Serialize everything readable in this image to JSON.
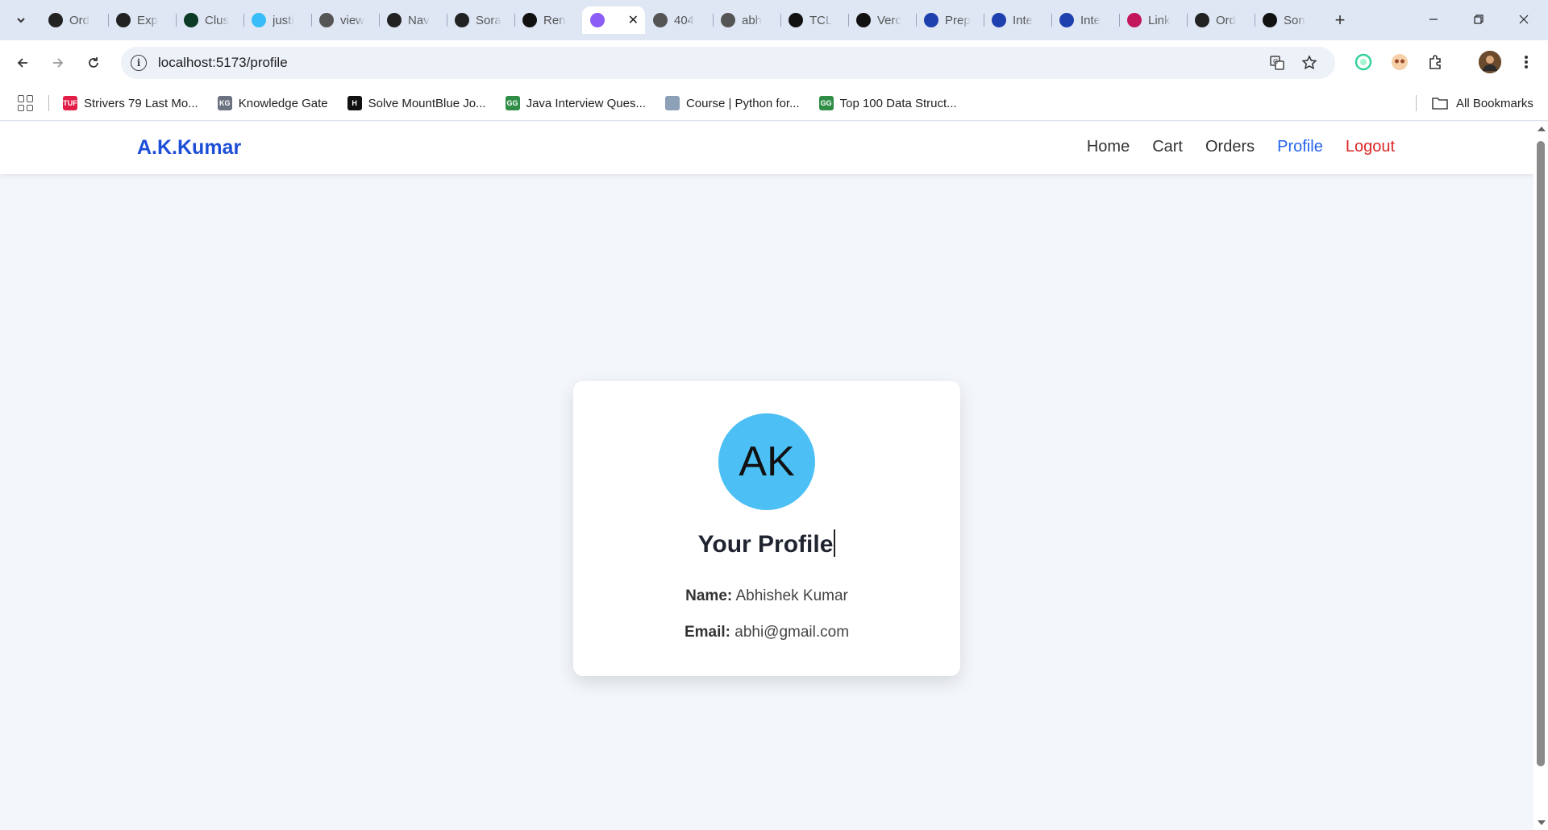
{
  "browser": {
    "tabs": [
      {
        "title": "Ord",
        "icon": "openai-icon",
        "color": "#222222"
      },
      {
        "title": "Exp",
        "icon": "express-icon",
        "color": "#222222"
      },
      {
        "title": "Clus",
        "icon": "mongodb-icon",
        "color": "#0b3b24"
      },
      {
        "title": "justi",
        "icon": "tailwind-icon",
        "color": "#38bdf8"
      },
      {
        "title": "view",
        "icon": "globe-icon",
        "color": "#555555"
      },
      {
        "title": "Nav",
        "icon": "openai-icon",
        "color": "#222222"
      },
      {
        "title": "Sora",
        "icon": "play-icon",
        "color": "#222222"
      },
      {
        "title": "Ren",
        "icon": "render-icon",
        "color": "#111111"
      },
      {
        "title": "",
        "icon": "vite-icon",
        "color": "#8b5cf6",
        "active": true
      },
      {
        "title": "404",
        "icon": "globe-icon",
        "color": "#555555"
      },
      {
        "title": "abh",
        "icon": "globe-icon",
        "color": "#555555"
      },
      {
        "title": "TCL",
        "icon": "amazon-icon",
        "color": "#111111"
      },
      {
        "title": "Verc",
        "icon": "vercel-icon",
        "color": "#111111"
      },
      {
        "title": "Prep",
        "icon": "interviewbit-icon",
        "color": "#1e40af"
      },
      {
        "title": "Inte",
        "icon": "interviewbit-icon",
        "color": "#1e40af"
      },
      {
        "title": "Inte",
        "icon": "interviewbit-icon",
        "color": "#1e40af"
      },
      {
        "title": "Link",
        "icon": "link-icon",
        "color": "#c2185b"
      },
      {
        "title": "Ord",
        "icon": "openai-icon",
        "color": "#222222"
      },
      {
        "title": "Son",
        "icon": "amazon-icon",
        "color": "#111111"
      }
    ],
    "url": "localhost:5173/profile",
    "bookmarks": [
      {
        "label": "Strivers 79 Last Mo...",
        "icon": "tuf-icon",
        "color": "#e11d48",
        "badge": "TUF"
      },
      {
        "label": "Knowledge Gate",
        "icon": "kg-icon",
        "color": "#6b7280",
        "badge": "KG"
      },
      {
        "label": "Solve MountBlue Jo...",
        "icon": "hackerearth-icon",
        "color": "#111111",
        "badge": "H"
      },
      {
        "label": "Java Interview Ques...",
        "icon": "gfg-icon",
        "color": "#2f8d46",
        "badge": "GG"
      },
      {
        "label": "Course | Python for...",
        "icon": "course-icon",
        "color": "#8ca0b8",
        "badge": ""
      },
      {
        "label": "Top 100 Data Struct...",
        "icon": "gfg-icon",
        "color": "#2f8d46",
        "badge": "GG"
      }
    ],
    "all_bookmarks": "All Bookmarks"
  },
  "site": {
    "brand": "A.K.Kumar",
    "nav": [
      {
        "label": "Home"
      },
      {
        "label": "Cart"
      },
      {
        "label": "Orders"
      },
      {
        "label": "Profile",
        "current": true
      },
      {
        "label": "Logout",
        "danger": true
      }
    ]
  },
  "profile": {
    "initials": "AK",
    "title": "Your Profile",
    "name_label": "Name:",
    "name": "Abhishek Kumar",
    "email_label": "Email:",
    "email": "abhi@gmail.com"
  }
}
